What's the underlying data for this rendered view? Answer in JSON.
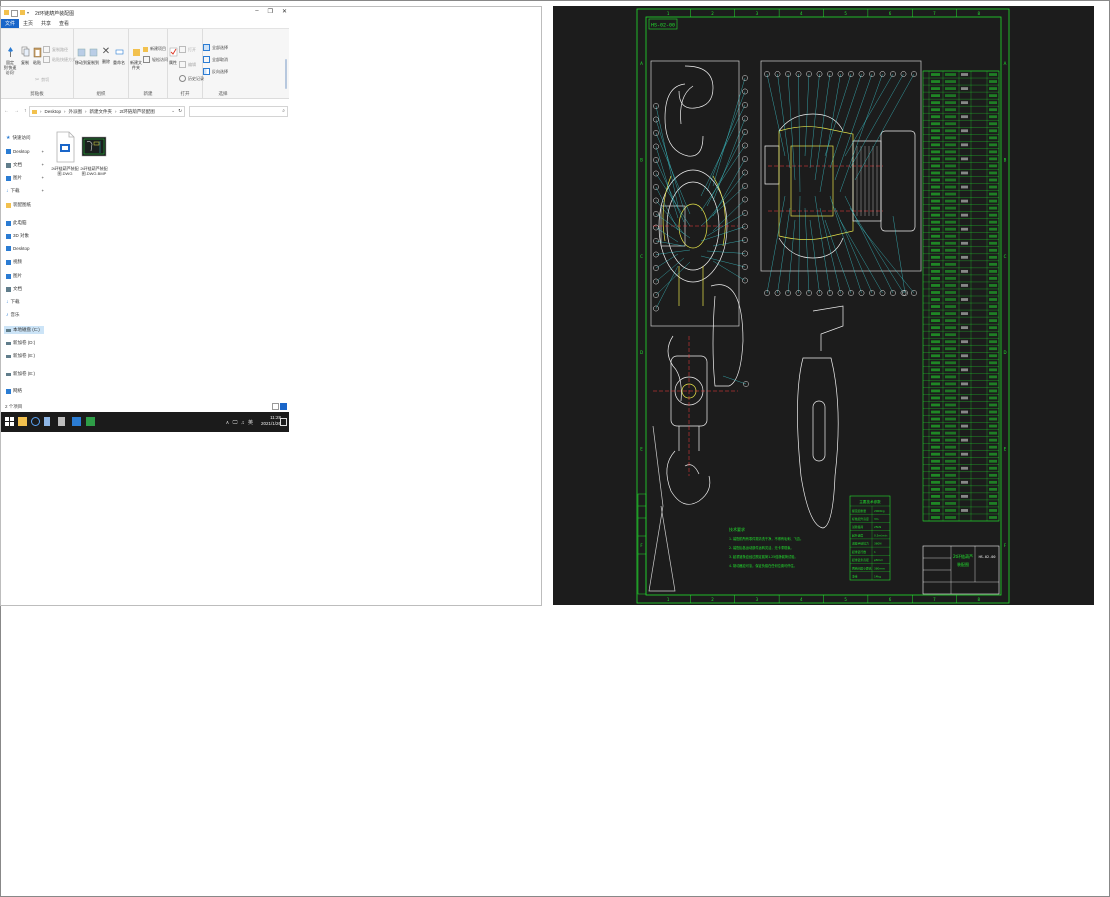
{
  "explorer": {
    "title": "2t环链葫芦装配图",
    "tabs": [
      "文件",
      "主页",
      "共享",
      "查看"
    ],
    "ribbon": {
      "clipboard": {
        "label": "剪贴板",
        "pin": "固定到'快速访问'",
        "copy": "复制",
        "paste": "粘贴",
        "copy_path": "复制路径",
        "paste_shortcut": "粘贴快捷方式",
        "cut": "剪切"
      },
      "organize": {
        "label": "组织",
        "move_to": "移动到",
        "copy_to": "复制到",
        "delete": "删除",
        "rename": "重命名"
      },
      "new": {
        "label": "新建",
        "new_folder": "新建文件夹",
        "new_item": "新建项目",
        "easy_access": "轻松访问"
      },
      "open": {
        "label": "打开",
        "properties": "属性",
        "open": "打开",
        "edit": "编辑",
        "history": "历史记录"
      },
      "select": {
        "label": "选择",
        "select_all": "全部选择",
        "select_none": "全部取消",
        "invert": "反向选择"
      }
    },
    "address": {
      "crumbs": [
        "Desktop",
        "外派图",
        "新建文件夹",
        "2t环链葫芦装配图"
      ],
      "separator": "›",
      "refresh": "↻"
    },
    "nav": [
      {
        "label": "快速访问",
        "icon": "star-icon",
        "color": "#2b7cd3"
      },
      {
        "label": "Desktop",
        "icon": "desktop-icon",
        "color": "#2b7cd3"
      },
      {
        "label": "文档",
        "icon": "document-icon",
        "color": "#607d8b"
      },
      {
        "label": "图片",
        "icon": "picture-icon",
        "color": "#2b7cd3"
      },
      {
        "label": "下载",
        "icon": "download-icon",
        "color": "#2b7cd3"
      },
      {
        "label": "装配图纸",
        "icon": "folder-icon",
        "color": "#f2c14e"
      },
      {
        "label": "此电脑",
        "icon": "computer-icon",
        "color": "#2b7cd3"
      },
      {
        "label": "3D 对象",
        "icon": "cube-icon",
        "color": "#2b7cd3"
      },
      {
        "label": "Desktop",
        "icon": "desktop-icon",
        "color": "#2b7cd3"
      },
      {
        "label": "视频",
        "icon": "video-icon",
        "color": "#2b7cd3"
      },
      {
        "label": "图片",
        "icon": "picture-icon",
        "color": "#2b7cd3"
      },
      {
        "label": "文档",
        "icon": "document-icon",
        "color": "#607d8b"
      },
      {
        "label": "下载",
        "icon": "download-icon",
        "color": "#2b7cd3"
      },
      {
        "label": "音乐",
        "icon": "music-icon",
        "color": "#2b7cd3"
      },
      {
        "label": "本地磁盘 (C:)",
        "icon": "drive-icon",
        "color": "#607d8b"
      },
      {
        "label": "新加卷 (D:)",
        "icon": "drive-icon",
        "color": "#607d8b"
      },
      {
        "label": "新加卷 (E:)",
        "icon": "drive-icon",
        "color": "#607d8b"
      },
      {
        "label": "新加卷 (E:)",
        "icon": "drive-icon",
        "color": "#607d8b"
      },
      {
        "label": "网络",
        "icon": "network-icon",
        "color": "#2b7cd3"
      }
    ],
    "files": [
      {
        "name_line1": "2t环链葫芦装配",
        "name_line2": "图.DWG"
      },
      {
        "name_line1": "2t环链葫芦装配",
        "name_line2": "图.DWG.BMP"
      }
    ],
    "status": "2 个项目",
    "taskbar": {
      "time": "11:28",
      "date": "2021/1/26",
      "tray_symbols": "∧ 🖵 ♫ 英"
    }
  },
  "cad": {
    "title_box": "HS-02-00",
    "col_numbers": [
      "1",
      "2",
      "3",
      "4",
      "5",
      "6",
      "7",
      "8"
    ],
    "row_letters": [
      "A",
      "B",
      "C",
      "D",
      "E",
      "F"
    ],
    "notes_title": "技术要求",
    "notes_lines": [
      "1. 装配前所有零件需清洗干净，不得有毛刺、飞边。",
      "2. 装配后各运动部件运转灵活，无卡滞现象。",
      "3. 起重链条应经过额定载荷1.25倍静载荷试验。",
      "4. 制动器应可靠，保证负载在任何位置可停住。"
    ],
    "params_title": "主要技术参数",
    "params": [
      {
        "k": "额定起重量",
        "v": "2000kg"
      },
      {
        "k": "标准起升高度",
        "v": "3m"
      },
      {
        "k": "试验载荷",
        "v": "25kN"
      },
      {
        "k": "起升速度",
        "v": "0.5m/min"
      },
      {
        "k": "满载手链拉力",
        "v": "360N"
      },
      {
        "k": "起重链行数",
        "v": "1"
      },
      {
        "k": "起重链条直径",
        "v": "φ8mm"
      },
      {
        "k": "两钩间最小距离",
        "v": "380mm"
      },
      {
        "k": "净重",
        "v": "14kg"
      }
    ],
    "title_block_name": "2t环链葫芦",
    "title_block_sub": "装配图",
    "title_block_code": "HS-02-00",
    "colors": {
      "background": "#1c1c1c",
      "frame": "#22e02e",
      "line": "#f2f2f2",
      "accent_yellow": "#e8e64a",
      "accent_cyan": "#3fd8e0",
      "accent_red": "#ff3a3a"
    }
  }
}
